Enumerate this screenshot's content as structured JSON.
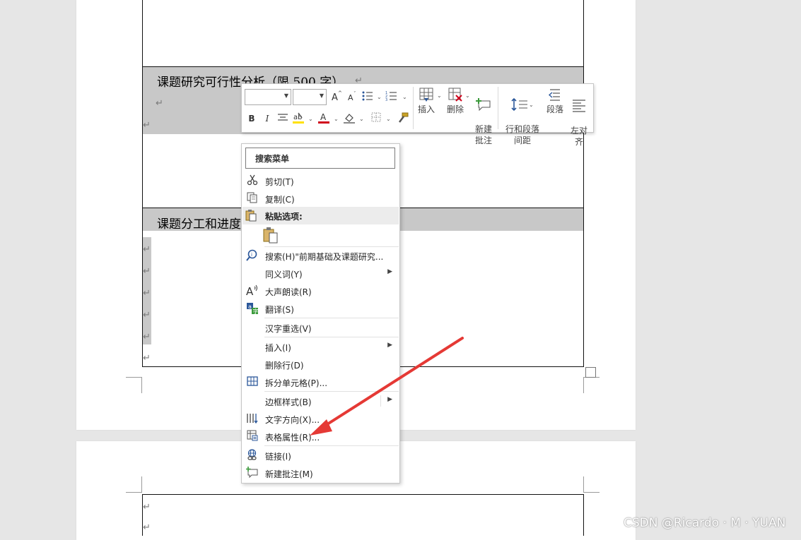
{
  "document": {
    "heading_feasibility": "课题研究可行性分析（限 500 字）",
    "heading_division": "课题分工和进度",
    "paragraph_mark": "↵"
  },
  "mini_toolbar": {
    "font_name": "",
    "font_size": "",
    "insert_label": "插入",
    "delete_label": "删除",
    "new_comment_label": "新建\n批注",
    "line_spacing_label": "行和段落\n间距",
    "paragraph_label": "段落",
    "align_left_label": "左对\n齐",
    "icons": [
      "grow-font-icon",
      "shrink-font-icon",
      "bullets-icon",
      "numbering-icon",
      "bold-icon",
      "italic-icon",
      "center-icon",
      "highlight-icon",
      "font-color-icon",
      "shading-icon",
      "borders-icon",
      "format-painter-icon"
    ]
  },
  "context_menu": {
    "search_label": "搜索菜单",
    "items": [
      {
        "label": "剪切(T)",
        "icon": "scissors-icon"
      },
      {
        "label": "复制(C)",
        "icon": "copy-icon"
      },
      {
        "label": "粘贴选项:",
        "icon": "paste-icon"
      },
      {
        "label": "搜索(H)\"前期基础及课题研究...",
        "icon": "search-icon"
      },
      {
        "label": "同义词(Y)",
        "icon": ""
      },
      {
        "label": "大声朗读(R)",
        "icon": "read-aloud-icon"
      },
      {
        "label": "翻译(S)",
        "icon": "translate-icon"
      },
      {
        "label": "汉字重选(V)",
        "icon": ""
      },
      {
        "label": "插入(I)",
        "icon": ""
      },
      {
        "label": "删除行(D)",
        "icon": ""
      },
      {
        "label": "拆分单元格(P)...",
        "icon": "split-cells-icon"
      },
      {
        "label": "边框样式(B)",
        "icon": ""
      },
      {
        "label": "文字方向(X)...",
        "icon": "text-direction-icon"
      },
      {
        "label": "表格属性(R)...",
        "icon": "table-properties-icon"
      },
      {
        "label": "链接(I)",
        "icon": "link-icon"
      },
      {
        "label": "新建批注(M)",
        "icon": "new-comment-icon"
      }
    ]
  },
  "colors": {
    "annotation_arrow": "#e53935",
    "shading": "#c8c8c8",
    "highlight": "#ffe100",
    "font_color": "#d0021b"
  },
  "watermark": "CSDN @Ricardo · M · YUAN"
}
